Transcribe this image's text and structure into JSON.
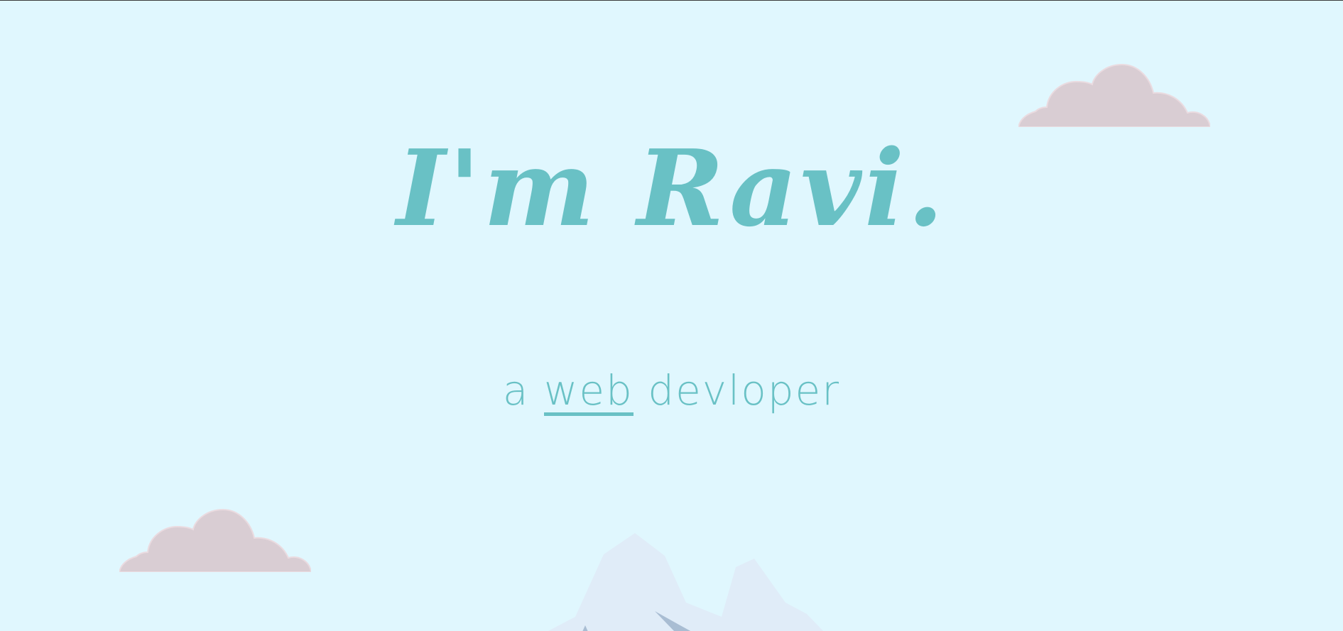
{
  "hero": {
    "title": "I'm Ravi.",
    "tagline_prefix": "a",
    "tagline_role": "web",
    "tagline_suffix": "devloper"
  },
  "decor": {
    "cloud_top_right": "cloud-icon",
    "cloud_bottom_left": "cloud-icon",
    "mountain": "mountain-icon"
  },
  "colors": {
    "background": "#e0f7fe",
    "accent": "#69c1c5",
    "cloud": "#d9cdd3",
    "mountain": "#e0ecf8",
    "mountain_shadow": "#a9bdd3"
  }
}
